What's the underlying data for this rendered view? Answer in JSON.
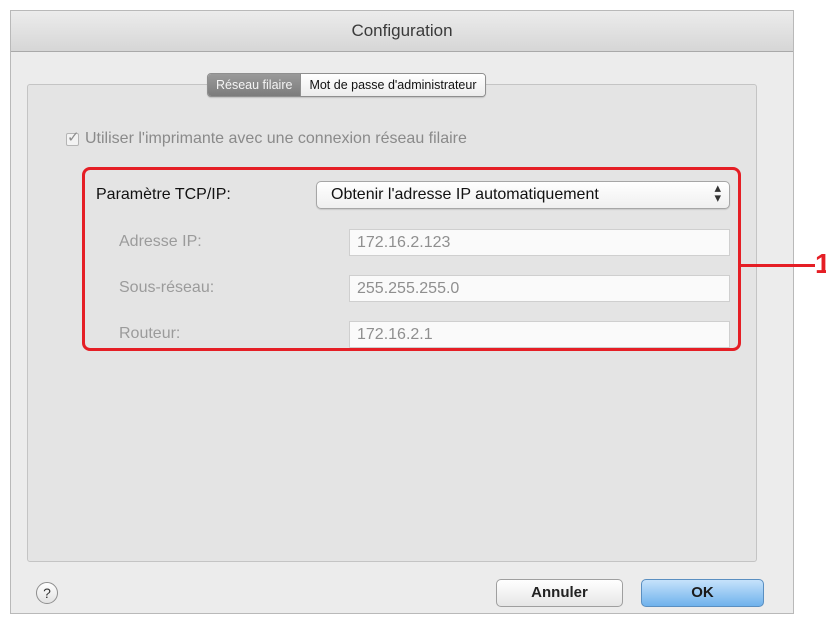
{
  "window": {
    "title": "Configuration"
  },
  "tabs": [
    {
      "label": "Réseau filaire",
      "active": true
    },
    {
      "label": "Mot de passe d'administrateur",
      "active": false
    }
  ],
  "wired": {
    "checkbox_label": "Utiliser l'imprimante avec une connexion réseau filaire",
    "checked": true
  },
  "tcpip": {
    "label": "Paramètre TCP/IP:",
    "selected": "Obtenir l'adresse IP automatiquement",
    "arrows": "⬍"
  },
  "fields": [
    {
      "label": "Adresse IP:",
      "value": "172.16.2.123"
    },
    {
      "label": "Sous-réseau:",
      "value": "255.255.255.0"
    },
    {
      "label": "Routeur:",
      "value": "172.16.2.1"
    }
  ],
  "callout": "1",
  "buttons": {
    "help": "?",
    "cancel": "Annuler",
    "ok": "OK"
  },
  "colors": {
    "highlight": "#e51e25",
    "ok_button": "#6fb2ec",
    "active_tab": "#8a8a8a"
  }
}
